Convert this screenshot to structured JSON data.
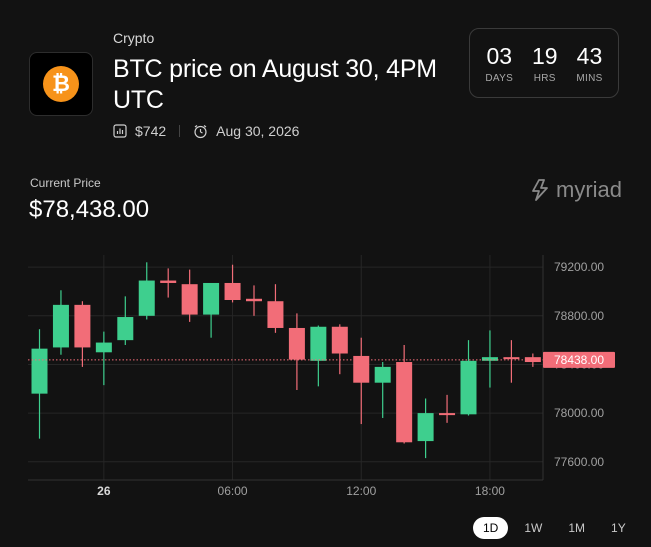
{
  "header": {
    "category": "Crypto",
    "title": "BTC price on August 30, 4PM UTC",
    "volume": "$742",
    "date": "Aug 30, 2026"
  },
  "countdown": [
    {
      "value": "03",
      "label": "DAYS"
    },
    {
      "value": "19",
      "label": "HRS"
    },
    {
      "value": "43",
      "label": "MINS"
    }
  ],
  "price": {
    "label": "Current Price",
    "value": "$78,438.00"
  },
  "brand": {
    "name": "myriad"
  },
  "colors": {
    "up": "#3ecf8e",
    "down": "#f26d78",
    "current_tag": "#f26d78",
    "bitcoin": "#f7931a"
  },
  "icons": [
    "bitcoin-icon",
    "volume-icon",
    "clock-icon",
    "myriad-logo-icon"
  ],
  "timeframes": [
    {
      "label": "1D",
      "active": true
    },
    {
      "label": "1W",
      "active": false
    },
    {
      "label": "1M",
      "active": false
    },
    {
      "label": "1Y",
      "active": false
    }
  ],
  "chart_data": {
    "type": "candlestick",
    "y_ticks": [
      {
        "value": 79200,
        "label": "79200.00"
      },
      {
        "value": 78800,
        "label": "78800.00"
      },
      {
        "value": 78400,
        "label": "78400.00"
      },
      {
        "value": 78000,
        "label": "78000.00"
      },
      {
        "value": 77600,
        "label": "77600.00"
      }
    ],
    "ylim": [
      77450,
      79300
    ],
    "x_ticks": [
      {
        "index": 3,
        "label": "26"
      },
      {
        "index": 9,
        "label": "06:00"
      },
      {
        "index": 15,
        "label": "12:00"
      },
      {
        "index": 21,
        "label": "18:00"
      }
    ],
    "current_price": {
      "value": 78438,
      "label": "78438.00"
    },
    "candles": [
      {
        "o": 78160,
        "h": 78690,
        "l": 77790,
        "c": 78530
      },
      {
        "o": 78540,
        "h": 79010,
        "l": 78480,
        "c": 78890
      },
      {
        "o": 78890,
        "h": 78920,
        "l": 78380,
        "c": 78540
      },
      {
        "o": 78500,
        "h": 78670,
        "l": 78230,
        "c": 78580
      },
      {
        "o": 78600,
        "h": 78960,
        "l": 78560,
        "c": 78790
      },
      {
        "o": 78800,
        "h": 79240,
        "l": 78770,
        "c": 79090
      },
      {
        "o": 79090,
        "h": 79190,
        "l": 78950,
        "c": 79070
      },
      {
        "o": 79060,
        "h": 79180,
        "l": 78750,
        "c": 78810
      },
      {
        "o": 78810,
        "h": 79060,
        "l": 78620,
        "c": 79070
      },
      {
        "o": 79070,
        "h": 79220,
        "l": 78910,
        "c": 78930
      },
      {
        "o": 78940,
        "h": 79050,
        "l": 78800,
        "c": 78920
      },
      {
        "o": 78920,
        "h": 79060,
        "l": 78660,
        "c": 78700
      },
      {
        "o": 78700,
        "h": 78820,
        "l": 78190,
        "c": 78440
      },
      {
        "o": 78430,
        "h": 78720,
        "l": 78220,
        "c": 78710
      },
      {
        "o": 78710,
        "h": 78730,
        "l": 78320,
        "c": 78490
      },
      {
        "o": 78470,
        "h": 78620,
        "l": 77910,
        "c": 78250
      },
      {
        "o": 78250,
        "h": 78420,
        "l": 77960,
        "c": 78380
      },
      {
        "o": 78420,
        "h": 78560,
        "l": 77750,
        "c": 77760
      },
      {
        "o": 77770,
        "h": 78120,
        "l": 77630,
        "c": 78000
      },
      {
        "o": 78000,
        "h": 78150,
        "l": 77920,
        "c": 77990
      },
      {
        "o": 77990,
        "h": 78600,
        "l": 77980,
        "c": 78430
      },
      {
        "o": 78430,
        "h": 78680,
        "l": 78210,
        "c": 78460
      },
      {
        "o": 78460,
        "h": 78600,
        "l": 78250,
        "c": 78450
      },
      {
        "o": 78460,
        "h": 78490,
        "l": 78380,
        "c": 78420
      }
    ]
  }
}
